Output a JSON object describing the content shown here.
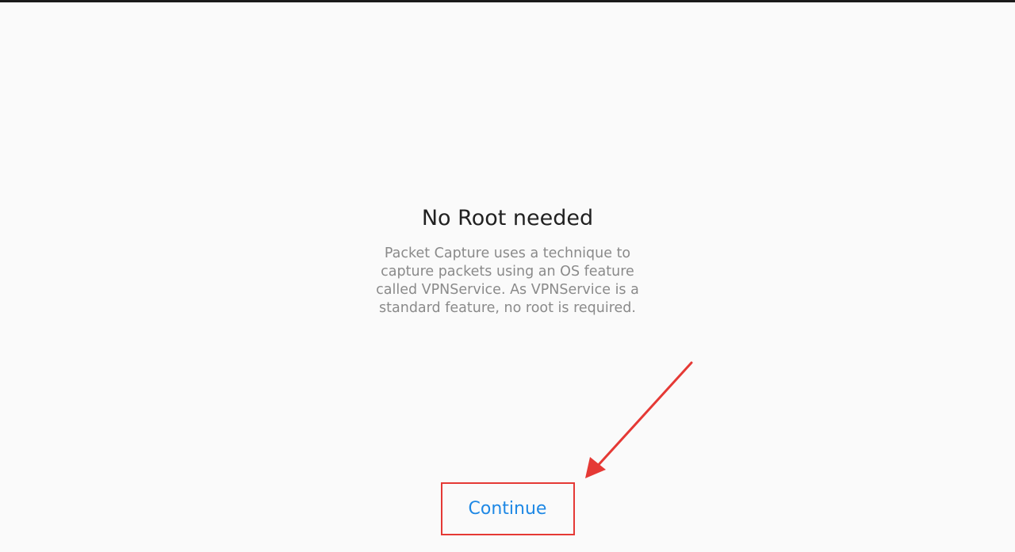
{
  "onboarding": {
    "title": "No Root needed",
    "description": "Packet Capture uses a technique to\ncapture packets using  an OS feature\ncalled VPNService.  As VPNService is a\nstandard feature, no root is required.",
    "continue_label": "Continue"
  },
  "colors": {
    "background": "#fafafa",
    "accent": "#1e88e5",
    "annotation": "#e53935"
  }
}
